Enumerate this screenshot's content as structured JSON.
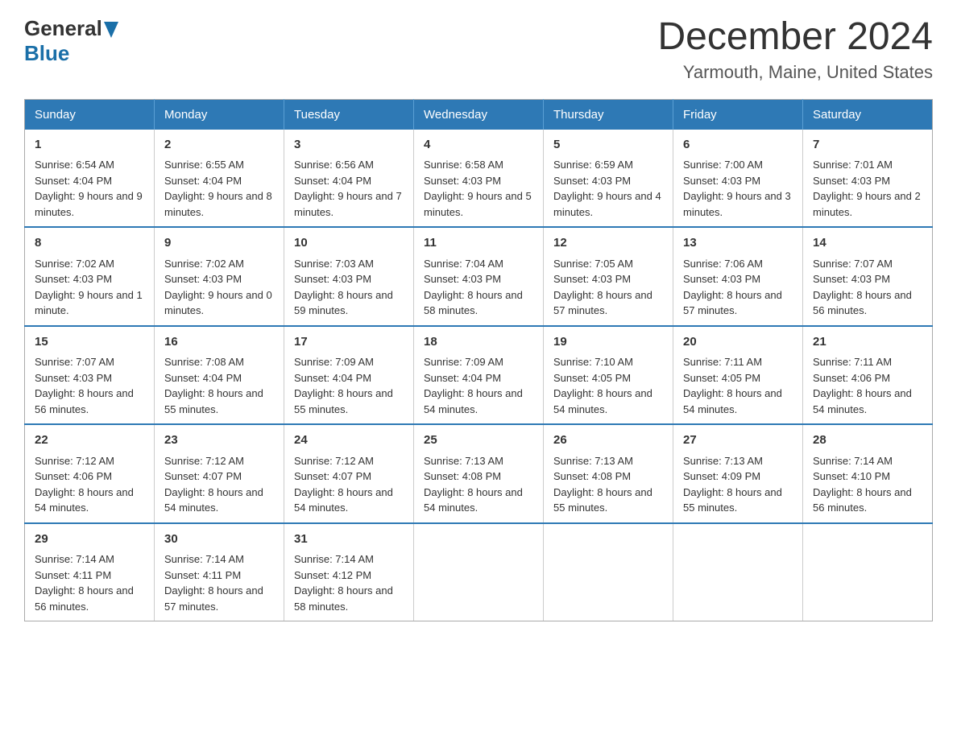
{
  "header": {
    "logo_general": "General",
    "logo_blue": "Blue",
    "month": "December 2024",
    "location": "Yarmouth, Maine, United States"
  },
  "days_of_week": [
    "Sunday",
    "Monday",
    "Tuesday",
    "Wednesday",
    "Thursday",
    "Friday",
    "Saturday"
  ],
  "weeks": [
    [
      {
        "day": "1",
        "sunrise": "6:54 AM",
        "sunset": "4:04 PM",
        "daylight": "9 hours and 9 minutes."
      },
      {
        "day": "2",
        "sunrise": "6:55 AM",
        "sunset": "4:04 PM",
        "daylight": "9 hours and 8 minutes."
      },
      {
        "day": "3",
        "sunrise": "6:56 AM",
        "sunset": "4:04 PM",
        "daylight": "9 hours and 7 minutes."
      },
      {
        "day": "4",
        "sunrise": "6:58 AM",
        "sunset": "4:03 PM",
        "daylight": "9 hours and 5 minutes."
      },
      {
        "day": "5",
        "sunrise": "6:59 AM",
        "sunset": "4:03 PM",
        "daylight": "9 hours and 4 minutes."
      },
      {
        "day": "6",
        "sunrise": "7:00 AM",
        "sunset": "4:03 PM",
        "daylight": "9 hours and 3 minutes."
      },
      {
        "day": "7",
        "sunrise": "7:01 AM",
        "sunset": "4:03 PM",
        "daylight": "9 hours and 2 minutes."
      }
    ],
    [
      {
        "day": "8",
        "sunrise": "7:02 AM",
        "sunset": "4:03 PM",
        "daylight": "9 hours and 1 minute."
      },
      {
        "day": "9",
        "sunrise": "7:02 AM",
        "sunset": "4:03 PM",
        "daylight": "9 hours and 0 minutes."
      },
      {
        "day": "10",
        "sunrise": "7:03 AM",
        "sunset": "4:03 PM",
        "daylight": "8 hours and 59 minutes."
      },
      {
        "day": "11",
        "sunrise": "7:04 AM",
        "sunset": "4:03 PM",
        "daylight": "8 hours and 58 minutes."
      },
      {
        "day": "12",
        "sunrise": "7:05 AM",
        "sunset": "4:03 PM",
        "daylight": "8 hours and 57 minutes."
      },
      {
        "day": "13",
        "sunrise": "7:06 AM",
        "sunset": "4:03 PM",
        "daylight": "8 hours and 57 minutes."
      },
      {
        "day": "14",
        "sunrise": "7:07 AM",
        "sunset": "4:03 PM",
        "daylight": "8 hours and 56 minutes."
      }
    ],
    [
      {
        "day": "15",
        "sunrise": "7:07 AM",
        "sunset": "4:03 PM",
        "daylight": "8 hours and 56 minutes."
      },
      {
        "day": "16",
        "sunrise": "7:08 AM",
        "sunset": "4:04 PM",
        "daylight": "8 hours and 55 minutes."
      },
      {
        "day": "17",
        "sunrise": "7:09 AM",
        "sunset": "4:04 PM",
        "daylight": "8 hours and 55 minutes."
      },
      {
        "day": "18",
        "sunrise": "7:09 AM",
        "sunset": "4:04 PM",
        "daylight": "8 hours and 54 minutes."
      },
      {
        "day": "19",
        "sunrise": "7:10 AM",
        "sunset": "4:05 PM",
        "daylight": "8 hours and 54 minutes."
      },
      {
        "day": "20",
        "sunrise": "7:11 AM",
        "sunset": "4:05 PM",
        "daylight": "8 hours and 54 minutes."
      },
      {
        "day": "21",
        "sunrise": "7:11 AM",
        "sunset": "4:06 PM",
        "daylight": "8 hours and 54 minutes."
      }
    ],
    [
      {
        "day": "22",
        "sunrise": "7:12 AM",
        "sunset": "4:06 PM",
        "daylight": "8 hours and 54 minutes."
      },
      {
        "day": "23",
        "sunrise": "7:12 AM",
        "sunset": "4:07 PM",
        "daylight": "8 hours and 54 minutes."
      },
      {
        "day": "24",
        "sunrise": "7:12 AM",
        "sunset": "4:07 PM",
        "daylight": "8 hours and 54 minutes."
      },
      {
        "day": "25",
        "sunrise": "7:13 AM",
        "sunset": "4:08 PM",
        "daylight": "8 hours and 54 minutes."
      },
      {
        "day": "26",
        "sunrise": "7:13 AM",
        "sunset": "4:08 PM",
        "daylight": "8 hours and 55 minutes."
      },
      {
        "day": "27",
        "sunrise": "7:13 AM",
        "sunset": "4:09 PM",
        "daylight": "8 hours and 55 minutes."
      },
      {
        "day": "28",
        "sunrise": "7:14 AM",
        "sunset": "4:10 PM",
        "daylight": "8 hours and 56 minutes."
      }
    ],
    [
      {
        "day": "29",
        "sunrise": "7:14 AM",
        "sunset": "4:11 PM",
        "daylight": "8 hours and 56 minutes."
      },
      {
        "day": "30",
        "sunrise": "7:14 AM",
        "sunset": "4:11 PM",
        "daylight": "8 hours and 57 minutes."
      },
      {
        "day": "31",
        "sunrise": "7:14 AM",
        "sunset": "4:12 PM",
        "daylight": "8 hours and 58 minutes."
      },
      null,
      null,
      null,
      null
    ]
  ],
  "labels": {
    "sunrise": "Sunrise:",
    "sunset": "Sunset:",
    "daylight": "Daylight:"
  }
}
